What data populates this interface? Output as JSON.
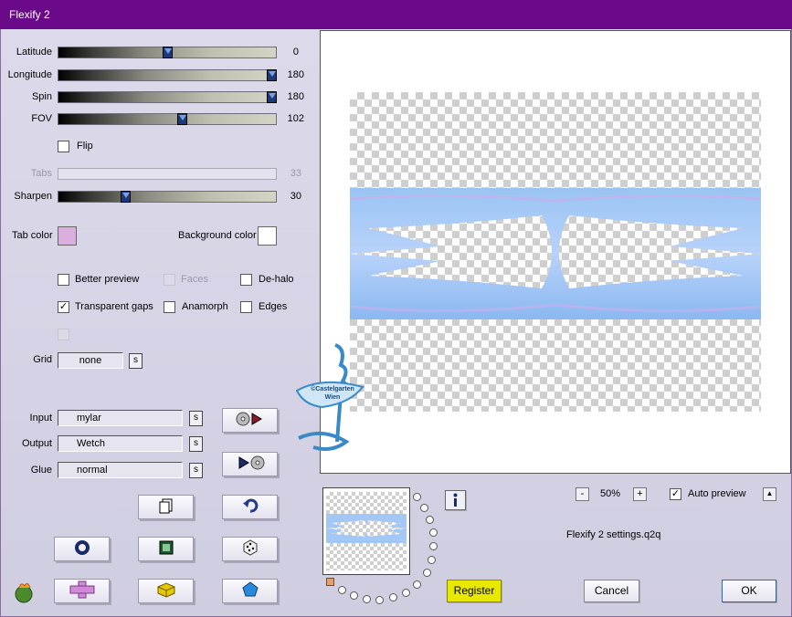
{
  "window": {
    "title": "Flexify 2"
  },
  "sliders": {
    "latitude": {
      "label": "Latitude",
      "value": "0",
      "position": 0.5
    },
    "longitude": {
      "label": "Longitude",
      "value": "180",
      "position": 1.0
    },
    "spin": {
      "label": "Spin",
      "value": "180",
      "position": 1.0
    },
    "fov": {
      "label": "FOV",
      "value": "102",
      "position": 0.57
    },
    "tabs": {
      "label": "Tabs",
      "value": "33",
      "position": 0.0
    },
    "sharpen": {
      "label": "Sharpen",
      "value": "30",
      "position": 0.3
    }
  },
  "flip": {
    "label": "Flip",
    "checked": false
  },
  "colors": {
    "tab_color_label": "Tab color",
    "tab_color": "#dcaee0",
    "background_color_label": "Background color",
    "background_color": "#ffffff",
    "title_bar": "#6a0a8a",
    "register_button": "#e8e800"
  },
  "options": {
    "better_preview": {
      "label": "Better preview",
      "checked": false
    },
    "faces": {
      "label": "Faces",
      "checked": false
    },
    "de_halo": {
      "label": "De-halo",
      "checked": false
    },
    "transparent_gaps": {
      "label": "Transparent gaps",
      "checked": true
    },
    "anamorph": {
      "label": "Anamorph",
      "checked": false
    },
    "edges": {
      "label": "Edges",
      "checked": false
    }
  },
  "grid": {
    "label": "Grid",
    "value": "none",
    "s_label": "s"
  },
  "io": {
    "input_label": "Input",
    "input_value": "mylar",
    "output_label": "Output",
    "output_value": "Wetch",
    "glue_label": "Glue",
    "glue_value": "normal",
    "s_label": "s"
  },
  "preview": {
    "zoom_minus": "-",
    "zoom": "50%",
    "zoom_plus": "+",
    "auto_preview_label": "Auto preview",
    "auto_preview_checked": true,
    "expand_label": "▲",
    "settings_file": "Flexify 2 settings.q2q",
    "watermark": "©Castelgarten Wien"
  },
  "buttons": {
    "register": "Register",
    "cancel": "Cancel",
    "ok": "OK"
  },
  "icons": {
    "info": "info-icon",
    "play_in": "play-in-icon",
    "play_out": "play-out-icon",
    "copy": "copy-icon",
    "undo": "undo-icon",
    "ring": "ring-icon",
    "square": "square-icon",
    "dice": "dice-icon",
    "plus": "plus-icon",
    "cube": "cube-icon",
    "gem": "gem-icon",
    "logo": "flaming-logo-icon"
  }
}
